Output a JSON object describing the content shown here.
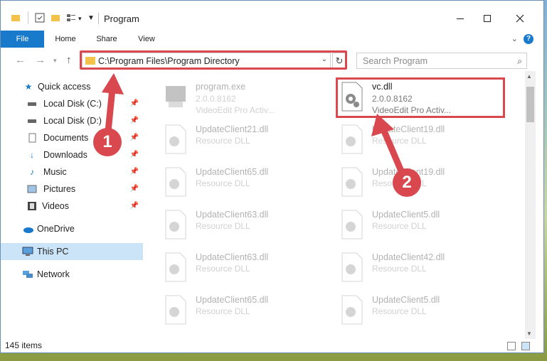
{
  "window": {
    "title": "Program"
  },
  "ribbon": {
    "tabs": [
      "File",
      "Home",
      "Share",
      "View"
    ],
    "help": "?"
  },
  "address": {
    "path": "C:\\Program Files\\Program Directory"
  },
  "search": {
    "placeholder": "Search Program"
  },
  "sidebar": {
    "items": [
      {
        "label": "Quick access",
        "icon": "star-icon"
      },
      {
        "label": "Local Disk (C:)",
        "icon": "drive-icon"
      },
      {
        "label": "Local Disk (D:)",
        "icon": "drive-icon"
      },
      {
        "label": "Documents",
        "icon": "documents-icon"
      },
      {
        "label": "Downloads",
        "icon": "download-icon"
      },
      {
        "label": "Music",
        "icon": "music-icon"
      },
      {
        "label": "Pictures",
        "icon": "pictures-icon"
      },
      {
        "label": "Videos",
        "icon": "videos-icon"
      },
      {
        "label": "OneDrive",
        "icon": "cloud-icon"
      },
      {
        "label": "This PC",
        "icon": "computer-icon"
      },
      {
        "label": "Network",
        "icon": "network-icon"
      }
    ]
  },
  "files": [
    {
      "name": "program.exe",
      "sub1": "2.0.0.8162",
      "sub2": "VideoEdit Pro Activ...",
      "faded": true
    },
    {
      "name": "vc.dll",
      "sub1": "2.0.0.8162",
      "sub2": "VideoEdit Pro Activ...",
      "faded": false
    },
    {
      "name": "UpdateClient21.dll",
      "sub1": "Resource DLL",
      "faded": true
    },
    {
      "name": "UpdateClient19.dll",
      "sub1": "Resource DLL",
      "faded": true
    },
    {
      "name": "UpdateClient65.dll",
      "sub1": "Resource DLL",
      "faded": true
    },
    {
      "name": "UpdateClient19.dll",
      "sub1": "Resource DLL",
      "faded": true
    },
    {
      "name": "UpdateClient63.dll",
      "sub1": "Resource DLL",
      "faded": true
    },
    {
      "name": "UpdateClient5.dll",
      "sub1": "Resource DLL",
      "faded": true
    },
    {
      "name": "UpdateClient63.dll",
      "sub1": "Resource DLL",
      "faded": true
    },
    {
      "name": "UpdateClient42.dll",
      "sub1": "Resource DLL",
      "faded": true
    },
    {
      "name": "UpdateClient65.dll",
      "sub1": "Resource DLL",
      "faded": true
    },
    {
      "name": "UpdateClient5.dll",
      "sub1": "Resource DLL",
      "faded": true
    }
  ],
  "status": {
    "items": "145 items"
  },
  "callouts": [
    "1",
    "2"
  ],
  "colors": {
    "accent": "#1979ca",
    "highlight": "#d9474f",
    "selected": "#cce4f7"
  }
}
